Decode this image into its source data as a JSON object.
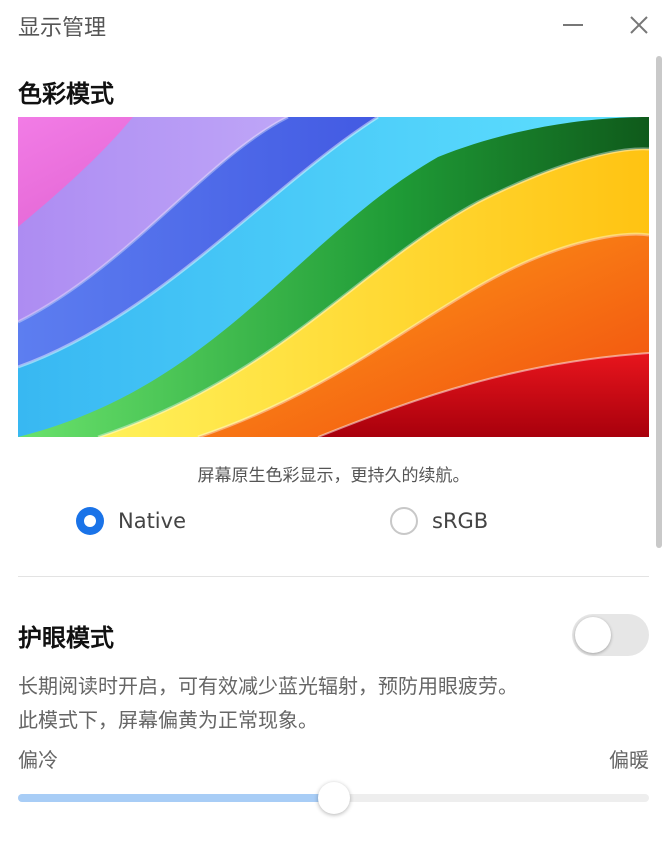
{
  "window": {
    "title": "显示管理",
    "minimize_icon": "minimize-icon",
    "close_icon": "close-icon"
  },
  "color_mode": {
    "title": "色彩模式",
    "caption": "屏幕原生色彩显示，更持久的续航。",
    "options": [
      {
        "label": "Native",
        "selected": true
      },
      {
        "label": "sRGB",
        "selected": false
      }
    ]
  },
  "eye_care": {
    "title": "护眼模式",
    "enabled": false,
    "desc_line1": "长期阅读时开启，可有效减少蓝光辐射，预防用眼疲劳。",
    "desc_line2": "此模式下，屏幕偏黄为正常现象。",
    "slider_left": "偏冷",
    "slider_right": "偏暖",
    "slider_value": 0.5
  },
  "colors": {
    "accent": "#1a73e8",
    "slider_fill": "#a8cdf6"
  }
}
